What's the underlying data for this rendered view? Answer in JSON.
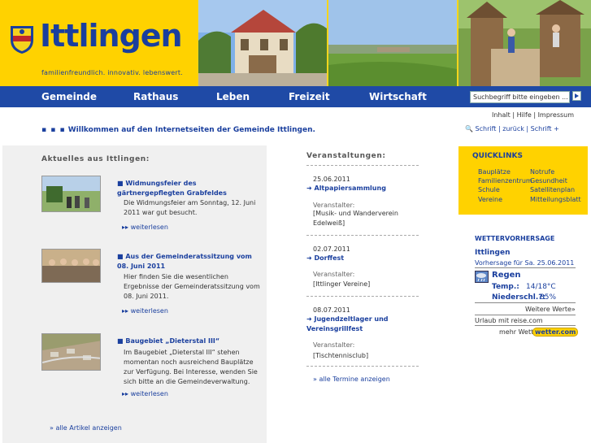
{
  "header": {
    "logo_text": "Ittlingen",
    "tagline": "familienfreundlich. innovativ. lebenswert."
  },
  "nav": {
    "items": [
      "Gemeinde",
      "Rathaus",
      "Leben",
      "Freizeit",
      "Wirtschaft"
    ],
    "search_placeholder": "Suchbegriff bitte eingeben ..."
  },
  "utility": {
    "inhalt": "Inhalt",
    "hilfe": "Hilfe",
    "impressum": "Impressum",
    "sep": "|"
  },
  "tools": {
    "schrift_minus": "Schrift",
    "zurueck": "zurück",
    "schrift_plus": "Schrift +",
    "sep": "|"
  },
  "welcome": {
    "dots": "▪ ▪ ▪",
    "text": "Willkommen auf den Internetseiten der Gemeinde Ittlingen."
  },
  "news": {
    "title": "Aktuelles aus Ittlingen:",
    "items": [
      {
        "title": "Widmungsfeier des gärtnergepflegten Grabfeldes",
        "body": "Die Widmungsfeier am Sonntag, 12. Juni 2011 war gut besucht.",
        "more": "weiterlesen"
      },
      {
        "title": "Aus der Gemeinderatssitzung vom 08. Juni 2011",
        "body": "Hier finden Sie die wesentlichen Ergebnisse der Gemeinderatssitzung vom 08. Juni 2011.",
        "more": "weiterlesen"
      },
      {
        "title": "Baugebiet „Dieterstal III“",
        "body": "Im Baugebiet „Dieterstal III“ stehen momentan noch ausreichend Bauplätze zur Verfügung. Bei Interesse, wenden Sie sich bitte an die Gemeindeverwaltung.",
        "more": "weiterlesen"
      }
    ],
    "all": "alle Artikel anzeigen"
  },
  "events": {
    "title": "Veranstaltungen:",
    "label": "Veranstalter:",
    "items": [
      {
        "date": "25.06.2011",
        "title": "Altpapiersammlung",
        "organizer": "[Musik- und Wanderverein Edelweiß]"
      },
      {
        "date": "02.07.2011",
        "title": "Dorffest",
        "organizer": "[Ittlinger Vereine]"
      },
      {
        "date": "08.07.2011",
        "title": "Jugendzeltlager und Vereinsgrillfest",
        "organizer": "[Tischtennisclub]"
      }
    ],
    "all": "alle Termine anzeigen"
  },
  "quicklinks": {
    "title": "QUICKLINKS",
    "left": [
      "Bauplätze",
      "Familienzentrum",
      "Schule",
      "Vereine"
    ],
    "right": [
      "Notrufe",
      "Gesundheit",
      "Satellitenplan",
      "Mitteilungsblatt"
    ]
  },
  "weather": {
    "title": "WETTERVORHERSAGE",
    "town": "Ittlingen",
    "forecast_for": "Vorhersage für Sa. 25.06.2011",
    "condition": "Regen",
    "temp_label": "Temp.:",
    "temp_value": "14/18°C",
    "rain_label": "Niederschl.?:",
    "rain_value": "85%",
    "more_values": "Weitere Werte»",
    "travel": "Urlaub mit reise.com",
    "more_weather": "mehr Wetter?",
    "badge": "wetter.com"
  },
  "colors": {
    "blue": "#1f4aa6",
    "yellow": "#ffd200",
    "gray_panel": "#f0f0f0"
  }
}
